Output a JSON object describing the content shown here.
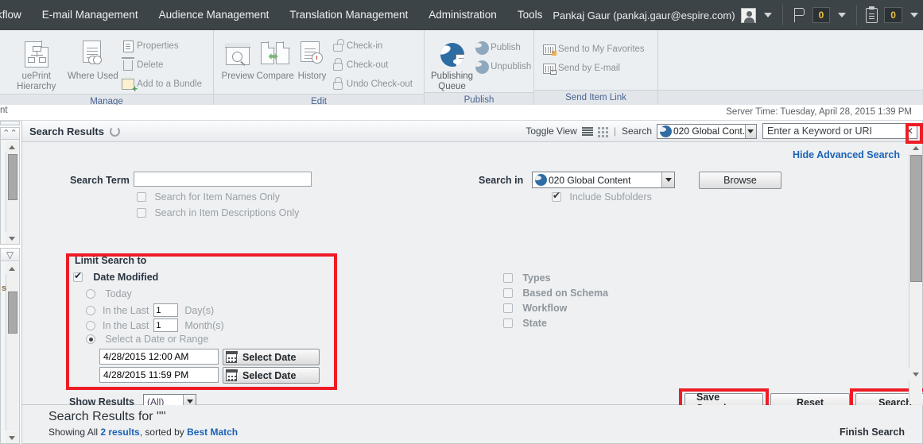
{
  "menubar": {
    "items": [
      "kflow",
      "E-mail Management",
      "Audience Management",
      "Translation Management",
      "Administration",
      "Tools"
    ],
    "user": "Pankaj Gaur (pankaj.gaur@espire.com)",
    "flag_count": "0",
    "clipboard_count": "0"
  },
  "ribbon": {
    "groups": [
      {
        "label": "Manage",
        "big": [
          {
            "name": "blueprint-hierarchy",
            "label": "uePrint Hierarchy"
          },
          {
            "name": "where-used",
            "label": "Where Used"
          }
        ],
        "small": [
          {
            "name": "properties",
            "label": "Properties"
          },
          {
            "name": "delete",
            "label": "Delete"
          },
          {
            "name": "add-to-bundle",
            "label": "Add to a Bundle"
          }
        ]
      },
      {
        "label": "Edit",
        "big": [
          {
            "name": "preview",
            "label": "Preview"
          },
          {
            "name": "compare",
            "label": "Compare"
          },
          {
            "name": "history",
            "label": "History"
          }
        ],
        "small": [
          {
            "name": "check-in",
            "label": "Check-in"
          },
          {
            "name": "check-out",
            "label": "Check-out"
          },
          {
            "name": "undo-check-out",
            "label": "Undo Check-out"
          }
        ]
      },
      {
        "label": "Publish",
        "big": [
          {
            "name": "publishing-queue",
            "label": "Publishing",
            "label2": "Queue"
          }
        ],
        "small": [
          {
            "name": "publish",
            "label": "Publish"
          },
          {
            "name": "unpublish",
            "label": "Unpublish"
          }
        ]
      },
      {
        "label": "Send Item Link",
        "big": [],
        "small": [
          {
            "name": "send-to-my-favorites",
            "label": "Send to My Favorites"
          },
          {
            "name": "send-by-email",
            "label": "Send by E-mail"
          }
        ]
      }
    ]
  },
  "statusbar": {
    "server_time": "Server Time:  Tuesday, April 28, 2015 1:39 PM",
    "left_fragment": "nt"
  },
  "panel": {
    "title": "Search Results",
    "toggle_view_label": "Toggle View",
    "search_label": "Search",
    "scope_value": "020 Global Cont...",
    "keyword_placeholder": "Enter a Keyword or URI",
    "keyword_clear": "✕"
  },
  "advanced": {
    "hide_link": "Hide Advanced Search",
    "search_term_label": "Search Term",
    "search_term_value": "",
    "checkbox_names_only": "Search for Item Names Only",
    "checkbox_descriptions_only": "Search in Item Descriptions Only",
    "search_in_label": "Search in",
    "search_in_value": "020 Global Content",
    "browse_button": "Browse",
    "include_subfolders": "Include Subfolders",
    "limit_title": "Limit Search to",
    "date_modified": "Date Modified",
    "radio_today": "Today",
    "radio_last_days_pre": "In the Last",
    "radio_last_days_value": "1",
    "radio_last_days_post": "Day(s)",
    "radio_last_months_pre": "In the Last",
    "radio_last_months_value": "1",
    "radio_last_months_post": "Month(s)",
    "radio_range": "Select a Date or Range",
    "date_from": "4/28/2015 12:00 AM",
    "date_to": "4/28/2015 11:59 PM",
    "select_date_button": "Select Date",
    "filters": [
      "Types",
      "Based on Schema",
      "Workflow",
      "State"
    ],
    "show_results_label": "Show Results",
    "show_results_value": "(All)",
    "save_search_button": "Save Search...",
    "reset_button": "Reset",
    "search_button": "Search"
  },
  "results": {
    "heading": "Search Results for \"\"",
    "showing_pre": "Showing All ",
    "count_link": "2 results",
    "showing_mid": ", sorted by ",
    "sort_link": "Best Match",
    "finish_search": "Finish Search"
  },
  "colors": {
    "highlight_red": "#ee1c25",
    "menu_bg": "#3d4447",
    "link_blue": "#1b62b5"
  }
}
